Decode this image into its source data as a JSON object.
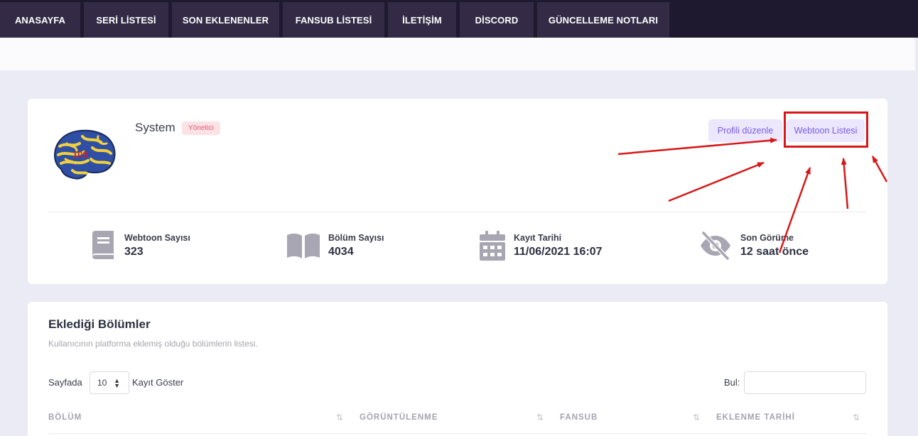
{
  "nav": {
    "tabs": [
      "ANASAYFA",
      "SERİ LİSTESİ",
      "SON EKLENENLER",
      "FANSUB LİSTESİ",
      "İLETİŞİM",
      "DİSCORD",
      "GÜNCELLEME NOTLARI"
    ]
  },
  "profile": {
    "username": "System",
    "role": "Yönetici",
    "edit_button": "Profili düzenle",
    "list_button": "Webtoon Listesi",
    "avatar_text": "100"
  },
  "stats": [
    {
      "label": "Webtoon Sayısı",
      "value": "323",
      "icon": "book-icon"
    },
    {
      "label": "Bölüm Sayısı",
      "value": "4034",
      "icon": "open-book-icon"
    },
    {
      "label": "Kayıt Tarihi",
      "value": "11/06/2021 16:07",
      "icon": "calendar-icon"
    },
    {
      "label": "Son Görüme",
      "value": "12 saat önce",
      "icon": "eye-off-icon"
    }
  ],
  "section": {
    "title": "Eklediği Bölümler",
    "subtitle": "Kullanıcının platforma eklemiş olduğu bölümlerin listesi.",
    "show_prefix": "Sayfada",
    "page_size": "10",
    "show_suffix": "Kayıt Göster",
    "search_label": "Bul:",
    "columns": [
      "BÖLÜM",
      "GÖRÜNTÜLENME",
      "FANSUB",
      "EKLENME TARİHİ"
    ]
  },
  "colors": {
    "nav_bg": "#1f1930",
    "tab_bg": "#332b45",
    "accent": "#7a5ce6",
    "annotation": "#d81818",
    "badge": "#ea5468"
  }
}
